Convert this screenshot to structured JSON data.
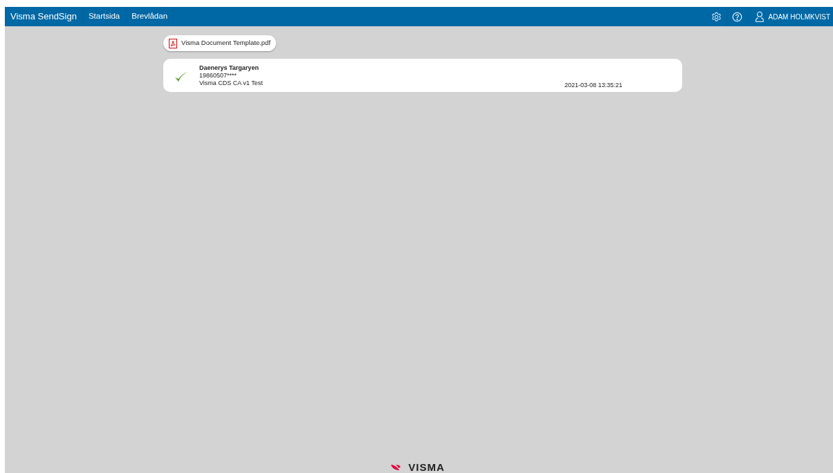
{
  "navbar": {
    "brand": "Visma SendSign",
    "links": [
      {
        "label": "Startsida",
        "selected": false
      },
      {
        "label": "Brevlådan",
        "selected": false
      }
    ],
    "user": "ADAM HOLMKVIST"
  },
  "document": {
    "file_name": "Visma Document Template.pdf"
  },
  "signatures": [
    {
      "signed": true,
      "name": "Daenerys Targaryen",
      "id_number": "19860507****",
      "method": "Visma CDS CA v1 Test",
      "timestamp": "2021-03-08 13:35:21"
    }
  ],
  "footer": {
    "logo_text": "VISMA"
  }
}
